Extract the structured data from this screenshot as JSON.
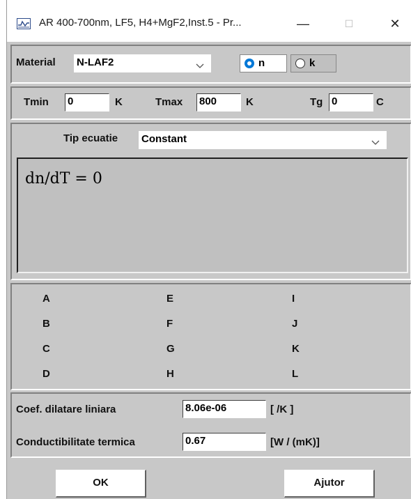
{
  "window": {
    "title": "AR 400-700nm, LF5, H4+MgF2,Inst.5 - Pr...",
    "minimize": "—",
    "maximize": "☐",
    "close": "✕"
  },
  "material": {
    "label": "Material",
    "value": "N-LAF2",
    "radio_n": "n",
    "radio_k": "k",
    "selected": "n"
  },
  "temps": {
    "tmin_label": "Tmin",
    "tmin_value": "0",
    "tmin_unit": "K",
    "tmax_label": "Tmax",
    "tmax_value": "800",
    "tmax_unit": "K",
    "tg_label": "Tg",
    "tg_value": "0",
    "tg_unit": "C"
  },
  "equation": {
    "type_label": "Tip ecuatie",
    "type_value": "Constant",
    "formula": "dn/dT = 0"
  },
  "coefficients": {
    "col1": [
      "A",
      "B",
      "C",
      "D"
    ],
    "col2": [
      "E",
      "F",
      "G",
      "H"
    ],
    "col3": [
      "I",
      "J",
      "K",
      "L"
    ]
  },
  "thermal": {
    "dilatare_label": "Coef. dilatare liniara",
    "dilatare_value": "8.06e-06",
    "dilatare_unit": "[ /K ]",
    "conduct_label": "Conductibilitate termica",
    "conduct_value": "0.67",
    "conduct_unit": "[W / (mK)]"
  },
  "buttons": {
    "ok": "OK",
    "help": "Ajutor"
  },
  "colors": {
    "panel": "#c8c8c8",
    "radio_selected": "#0078d7"
  }
}
